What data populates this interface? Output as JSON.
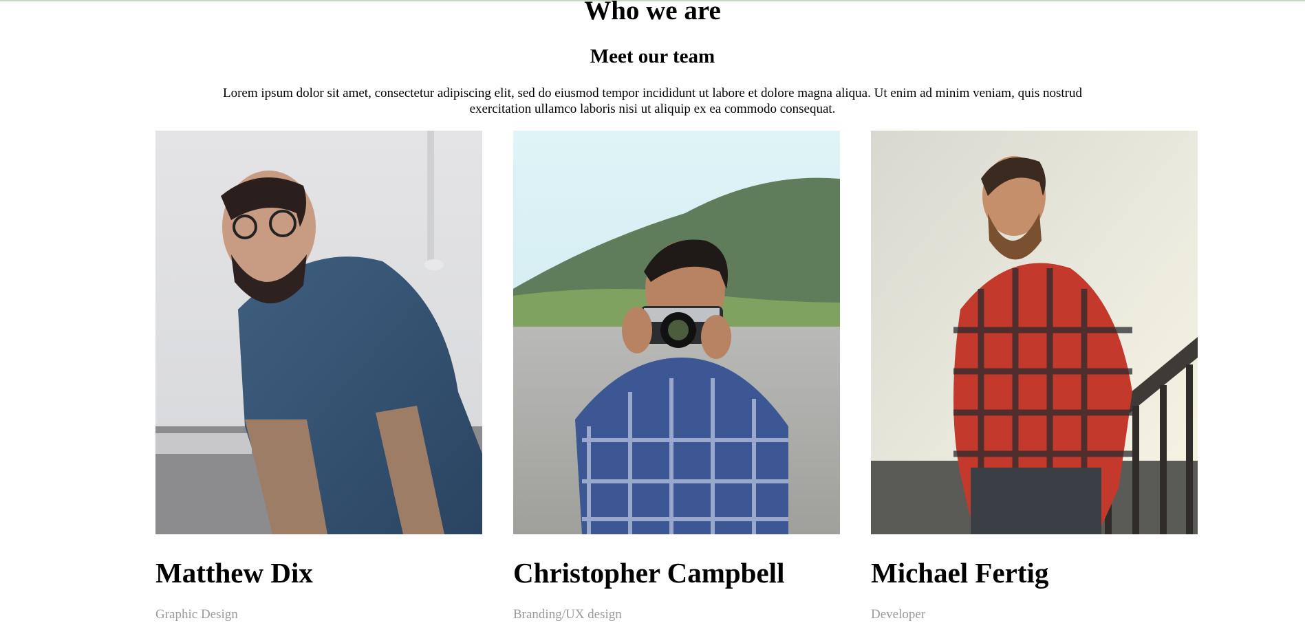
{
  "section": {
    "title": "Who we are",
    "subtitle": "Meet our team",
    "intro": "Lorem ipsum dolor sit amet, consectetur adipiscing elit, sed do eiusmod tempor incididunt ut labore et dolore magna aliqua. Ut enim ad minim veniam, quis nostrud exercitation ullamco laboris nisi ut aliquip ex ea commodo consequat."
  },
  "team": [
    {
      "name": "Matthew Dix",
      "role": "Graphic Design"
    },
    {
      "name": "Christopher Campbell",
      "role": "Branding/UX design"
    },
    {
      "name": "Michael Fertig",
      "role": "Developer"
    }
  ],
  "colors": {
    "role_text": "#9a9a9a",
    "top_border": "#c9d6c2"
  }
}
